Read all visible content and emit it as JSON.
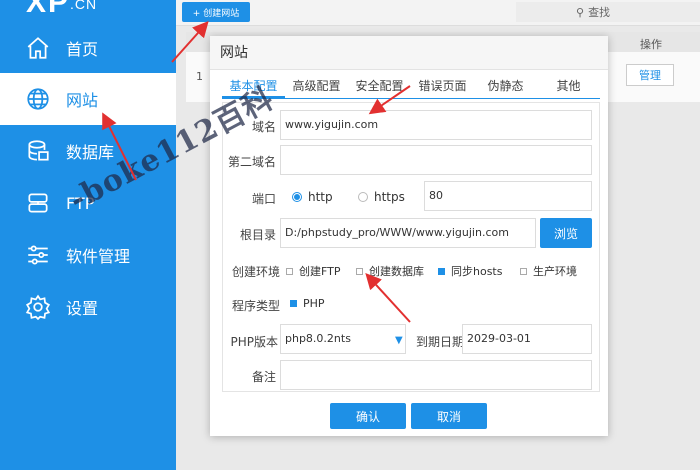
{
  "logo": {
    "text": "XP",
    "suffix": ".CN"
  },
  "sidebar": {
    "items": [
      {
        "label": "首页",
        "icon": "home-icon"
      },
      {
        "label": "网站",
        "icon": "globe-icon",
        "active": true
      },
      {
        "label": "数据库",
        "icon": "database-icon"
      },
      {
        "label": "FTP",
        "icon": "server-icon"
      },
      {
        "label": "软件管理",
        "icon": "sliders-icon"
      },
      {
        "label": "设置",
        "icon": "gear-icon"
      }
    ]
  },
  "toolbar": {
    "create_label": "+ 创建网站",
    "search_label": "查找"
  },
  "bg_table": {
    "op_header": "操作",
    "row_index": "1",
    "manage_label": "管理"
  },
  "modal": {
    "title": "网站",
    "tabs": [
      "基本配置",
      "高级配置",
      "安全配置",
      "错误页面",
      "伪静态",
      "其他"
    ],
    "form": {
      "domain_label": "域名",
      "domain_value": "www.yigujin.com",
      "second_domain_label": "第二域名",
      "second_domain_value": "",
      "port_label": "端口",
      "protocol_http": "http",
      "protocol_https": "https",
      "port_value": "80",
      "root_label": "根目录",
      "root_value": "D:/phpstudy_pro/WWW/www.yigujin.com",
      "browse_label": "浏览",
      "env_label": "创建环境",
      "env_options": [
        {
          "label": "创建FTP",
          "checked": false
        },
        {
          "label": "创建数据库",
          "checked": false
        },
        {
          "label": "同步hosts",
          "checked": true
        },
        {
          "label": "生产环境",
          "checked": false
        }
      ],
      "program_label": "程序类型",
      "program_option": {
        "label": "PHP",
        "checked": true
      },
      "php_label": "PHP版本",
      "php_value": "php8.0.2nts",
      "expire_label": "到期日期",
      "expire_value": "2029-03-01",
      "remark_label": "备注",
      "remark_value": ""
    },
    "confirm_label": "确认",
    "cancel_label": "取消"
  },
  "watermark": {
    "text": "-boke112百科"
  },
  "colors": {
    "accent": "#1e90e6",
    "arrow": "#e23030"
  }
}
